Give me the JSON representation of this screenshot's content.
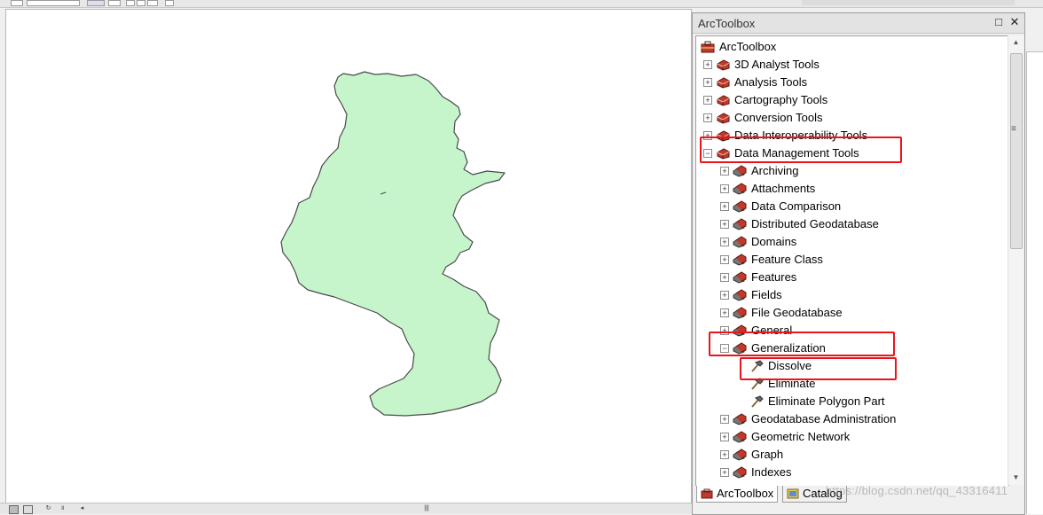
{
  "panel": {
    "title": "ArcToolbox",
    "pin_glyph": "□",
    "close_glyph": "✕"
  },
  "tree": {
    "root": "ArcToolbox",
    "toolboxes": [
      {
        "label": "3D Analyst Tools",
        "state": "collapsed"
      },
      {
        "label": "Analysis Tools",
        "state": "collapsed"
      },
      {
        "label": "Cartography Tools",
        "state": "collapsed"
      },
      {
        "label": "Conversion Tools",
        "state": "collapsed"
      },
      {
        "label": "Data Interoperability Tools",
        "state": "collapsed"
      },
      {
        "label": "Data Management Tools",
        "state": "expanded"
      }
    ],
    "toolsets": [
      {
        "label": "Archiving",
        "state": "collapsed"
      },
      {
        "label": "Attachments",
        "state": "collapsed"
      },
      {
        "label": "Data Comparison",
        "state": "collapsed"
      },
      {
        "label": "Distributed Geodatabase",
        "state": "collapsed"
      },
      {
        "label": "Domains",
        "state": "collapsed"
      },
      {
        "label": "Feature Class",
        "state": "collapsed"
      },
      {
        "label": "Features",
        "state": "collapsed"
      },
      {
        "label": "Fields",
        "state": "collapsed"
      },
      {
        "label": "File Geodatabase",
        "state": "collapsed"
      },
      {
        "label": "General",
        "state": "collapsed"
      },
      {
        "label": "Generalization",
        "state": "expanded"
      }
    ],
    "tools": [
      {
        "label": "Dissolve"
      },
      {
        "label": "Eliminate"
      },
      {
        "label": "Eliminate Polygon Part"
      }
    ],
    "more_toolsets": [
      {
        "label": "Geodatabase Administration",
        "state": "collapsed"
      },
      {
        "label": "Geometric Network",
        "state": "collapsed"
      },
      {
        "label": "Graph",
        "state": "collapsed"
      },
      {
        "label": "Indexes",
        "state": "collapsed"
      }
    ],
    "expander_collapsed": "+",
    "expander_expanded": "−"
  },
  "tabs": [
    {
      "label": "ArcToolbox",
      "active": true
    },
    {
      "label": "Catalog",
      "active": false
    }
  ],
  "watermark": "https://blog.csdn.net/qq_43316411",
  "colors": {
    "polygon_fill": "#c6f5cc",
    "polygon_stroke": "#4a4a4a",
    "highlight": "#e8151b",
    "toolbox_red": "#c0392b"
  },
  "icons": {
    "root": "arctoolbox-icon",
    "toolbox": "red-toolbox-icon",
    "toolset": "toolset-icon",
    "tool": "hammer-tool-icon"
  }
}
